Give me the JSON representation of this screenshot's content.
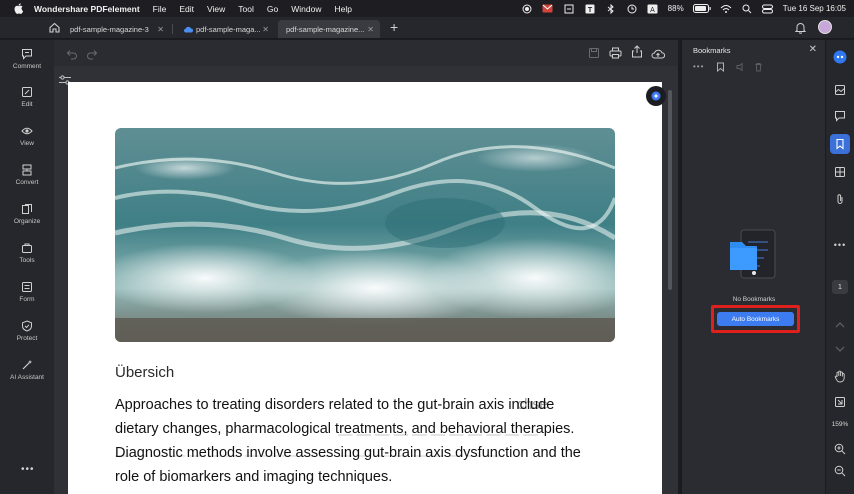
{
  "menubar": {
    "app_name": "Wondershare PDFelement",
    "items": [
      "File",
      "Edit",
      "View",
      "Tool",
      "Go",
      "Window",
      "Help"
    ],
    "battery": "88%",
    "datetime": "Tue 16 Sep  16:05"
  },
  "tabs": [
    {
      "label": "pdf-sample-magazine-3"
    },
    {
      "label": "pdf-sample-maga..."
    },
    {
      "label": "pdf-sample-magazine..."
    }
  ],
  "left_rail": [
    {
      "label": "Comment",
      "icon": "comment-icon"
    },
    {
      "label": "Edit",
      "icon": "edit-icon"
    },
    {
      "label": "View",
      "icon": "view-icon"
    },
    {
      "label": "Convert",
      "icon": "convert-icon"
    },
    {
      "label": "Organize",
      "icon": "organize-icon"
    },
    {
      "label": "Tools",
      "icon": "tools-icon"
    },
    {
      "label": "Form",
      "icon": "form-icon"
    },
    {
      "label": "Protect",
      "icon": "protect-icon"
    },
    {
      "label": "AI Assistant",
      "icon": "ai-assistant-icon"
    }
  ],
  "document": {
    "heading": "Übersich",
    "paragraph_lines": [
      "Approaches to treating disorders related to the gut-brain axis include",
      "dietary changes, pharmacological treatments, and behavioral therapies.",
      "Diagnostic methods involve assessing gut-brain axis dysfunction and the",
      "role of biomarkers and imaging techniques."
    ]
  },
  "bookmarks": {
    "title": "Bookmarks",
    "empty_text": "No Bookmarks",
    "auto_button": "Auto Bookmarks"
  },
  "right_rail": {
    "page_number": "1",
    "zoom": "159%"
  },
  "colors": {
    "accent": "#3d7cf0",
    "highlight": "#e0201c"
  }
}
